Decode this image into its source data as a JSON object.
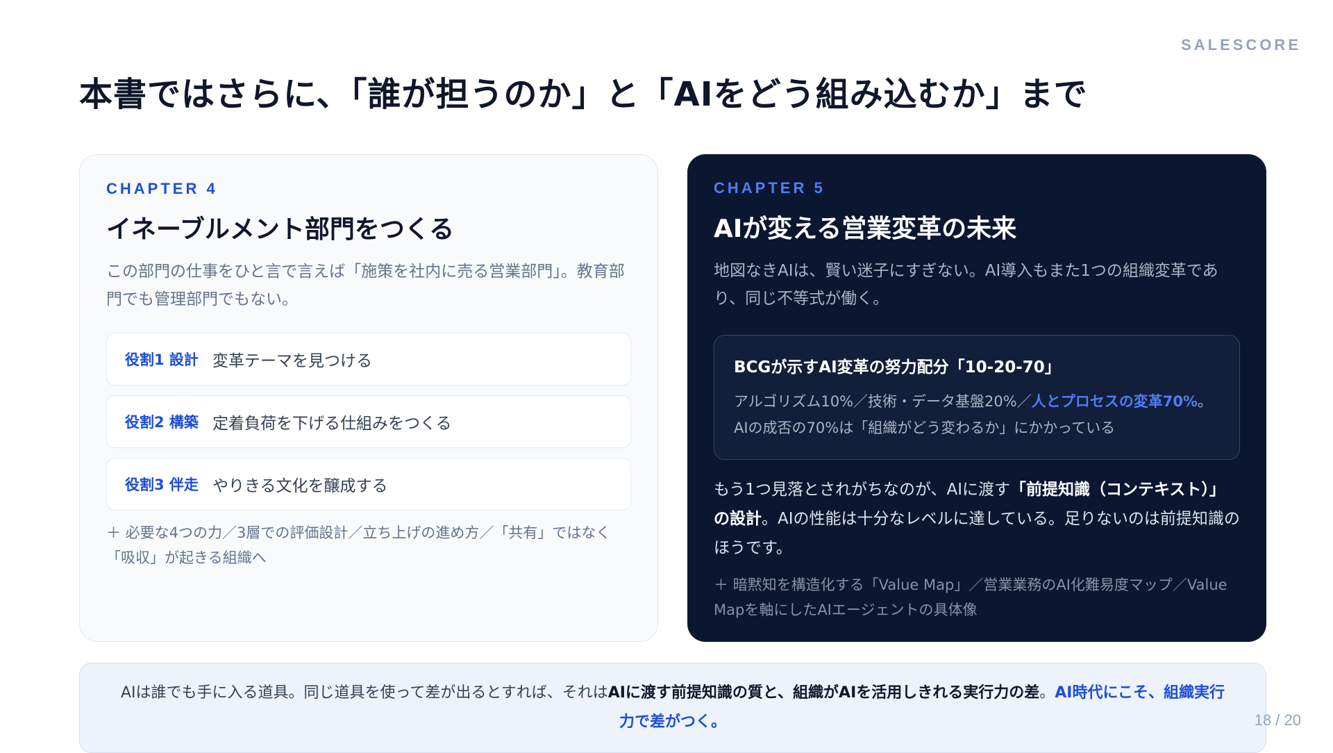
{
  "brand": "SALESCORE",
  "title": "本書ではさらに、「誰が担うのか」と「AIをどう組み込むか」まで",
  "chapter4": {
    "label": "CHAPTER 4",
    "title": "イネーブルメント部門をつくる",
    "lead": "この部門の仕事をひと言で言えば「施策を社内に売る営業部門」。教育部門でも管理部門でもない。",
    "roles": [
      {
        "tag": "役割1 設計",
        "text": "変革テーマを見つける"
      },
      {
        "tag": "役割2 構築",
        "text": "定着負荷を下げる仕組みをつくる"
      },
      {
        "tag": "役割3 伴走",
        "text": "やりきる文化を醸成する"
      }
    ],
    "more": "＋ 必要な4つの力／3層での評価設計／立ち上げの進め方／「共有」ではなく「吸収」が起きる組織へ"
  },
  "chapter5": {
    "label": "CHAPTER 5",
    "title": "AIが変える営業変革の未来",
    "lead": "地図なきAIは、賢い迷子にすぎない。AI導入もまた1つの組織変革であり、同じ不等式が働く。",
    "bcg": {
      "title": "BCGが示すAI変革の努力配分「10-20-70」",
      "body_pre": "アルゴリズム10%／技術・データ基盤20%／",
      "body_highlight": "人とプロセスの変革70%",
      "body_post": "。AIの成否の70%は「組織がどう変わるか」にかかっている"
    },
    "body_pre": "もう1つ見落とされがちなのが、AIに渡す",
    "body_bold": "「前提知識（コンテキスト）」の設計",
    "body_post": "。AIの性能は十分なレベルに達している。足りないのは前提知識のほうです。",
    "more": "＋ 暗黙知を構造化する「Value Map」／営業業務のAI化難易度マップ／Value Mapを軸にしたAIエージェントの具体像"
  },
  "summary": {
    "pre": "AIは誰でも手に入る道具。同じ道具を使って差が出るとすれば、それは",
    "bold": "AIに渡す前提知識の質と、組織がAIを活用しきれる実行力の差",
    "mid": "。",
    "accent": "AI時代にこそ、組織実行力で差がつく。"
  },
  "pager": "18 / 20"
}
